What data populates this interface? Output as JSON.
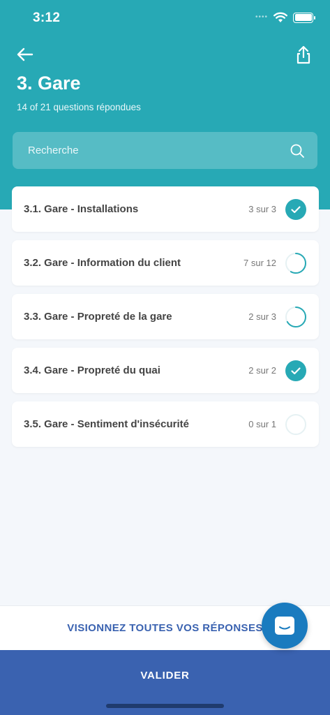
{
  "status_bar": {
    "time": "3:12",
    "signal_icon": "signal-dots",
    "wifi_icon": "wifi-icon",
    "battery_icon": "battery-icon"
  },
  "header": {
    "back_icon": "arrow-left-icon",
    "share_icon": "share-icon",
    "title": "3. Gare",
    "subtitle": "14 of 21 questions répondues"
  },
  "search": {
    "placeholder": "Recherche",
    "icon": "search-icon"
  },
  "items": [
    {
      "label": "3.1. Gare - Installations",
      "count": "3 sur 3",
      "answered": 3,
      "total": 3
    },
    {
      "label": "3.2. Gare - Information du client",
      "count": "7 sur 12",
      "answered": 7,
      "total": 12
    },
    {
      "label": "3.3. Gare - Propreté de la gare",
      "count": "2 sur 3",
      "answered": 2,
      "total": 3
    },
    {
      "label": "3.4. Gare  - Propreté du quai",
      "count": "2 sur 2",
      "answered": 2,
      "total": 2
    },
    {
      "label": "3.5. Gare - Sentiment d'insécurité",
      "count": "0 sur 1",
      "answered": 0,
      "total": 1
    }
  ],
  "footer": {
    "view_all_label": "VISIONNEZ TOUTES VOS RÉPONSES",
    "validate_label": "VALIDER",
    "chat_icon": "chat-icon"
  },
  "colors": {
    "accent": "#27a9b5",
    "primary": "#3a62b0",
    "ring_track": "#e6f1f3",
    "chat": "#1a7bbf"
  }
}
